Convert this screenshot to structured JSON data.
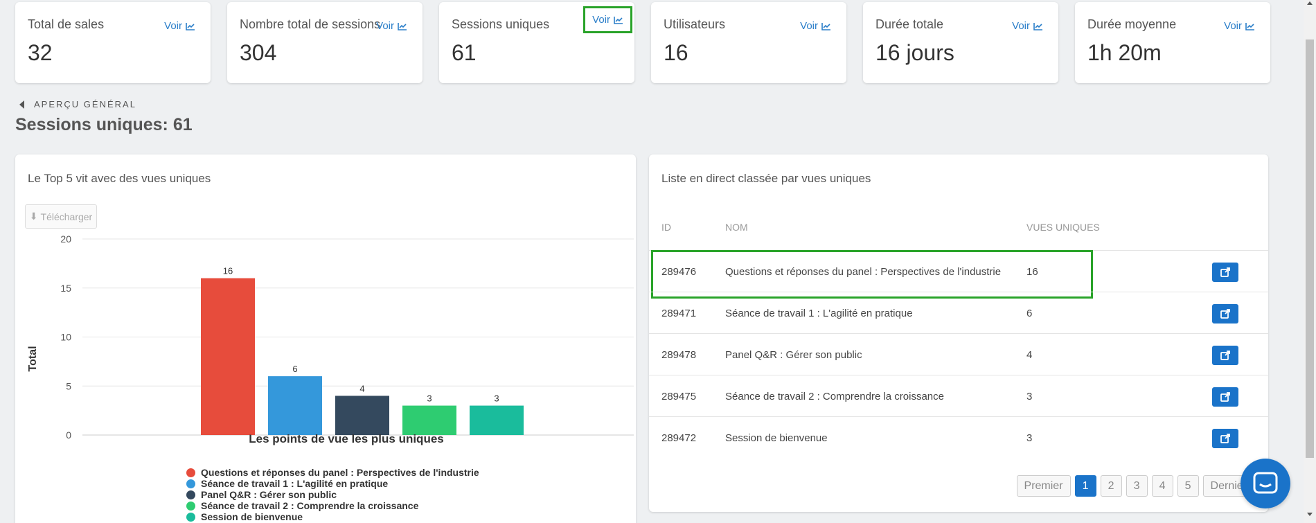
{
  "stats": [
    {
      "label": "Total de sales",
      "value": "32",
      "voir": "Voir"
    },
    {
      "label": "Nombre total de sessions",
      "value": "304",
      "voir": "Voir"
    },
    {
      "label": "Sessions uniques",
      "value": "61",
      "voir": "Voir"
    },
    {
      "label": "Utilisateurs",
      "value": "16",
      "voir": "Voir"
    },
    {
      "label": "Durée totale",
      "value": "16 jours",
      "voir": "Voir"
    },
    {
      "label": "Durée moyenne",
      "value": "1h 20m",
      "voir": "Voir"
    }
  ],
  "breadcrumb": "APERÇU GÉNÉRAL",
  "page_title": "Sessions uniques: 61",
  "left_panel": {
    "title": "Le Top 5 vit avec des vues uniques",
    "download_label": "Télécharger"
  },
  "chart_data": {
    "type": "bar",
    "title": "",
    "xlabel": "Les points de vue les plus uniques",
    "ylabel": "Total",
    "ylim": [
      0,
      20
    ],
    "yticks": [
      0,
      5,
      10,
      15,
      20
    ],
    "grid": true,
    "legend_position": "bottom",
    "categories": [
      "Questions et réponses du panel : Perspectives de l'industrie",
      "Séance de travail 1 : L'agilité en pratique",
      "Panel Q&R : Gérer son public",
      "Séance de travail 2 : Comprendre la croissance",
      "Session de bienvenue"
    ],
    "values": [
      16,
      6,
      4,
      3,
      3
    ],
    "colors": [
      "#e74c3c",
      "#3498db",
      "#34495e",
      "#2ecc71",
      "#1abc9c"
    ]
  },
  "right_panel": {
    "title": "Liste en direct classée par vues uniques",
    "headers": {
      "id": "ID",
      "name": "NOM",
      "views": "VUES UNIQUES"
    },
    "rows": [
      {
        "id": "289476",
        "name": "Questions et réponses du panel : Perspectives de l'industrie",
        "views": "16"
      },
      {
        "id": "289471",
        "name": "Séance de travail 1 : L'agilité en pratique",
        "views": "6"
      },
      {
        "id": "289478",
        "name": "Panel Q&R : Gérer son public",
        "views": "4"
      },
      {
        "id": "289475",
        "name": "Séance de travail 2 : Comprendre la croissance",
        "views": "3"
      },
      {
        "id": "289472",
        "name": "Session de bienvenue",
        "views": "3"
      }
    ],
    "pager": {
      "first": "Premier",
      "pages": [
        "1",
        "2",
        "3",
        "4",
        "5"
      ],
      "last": "Dernier"
    }
  },
  "accent_color": "#1a73c9",
  "highlight_color": "#29a329"
}
